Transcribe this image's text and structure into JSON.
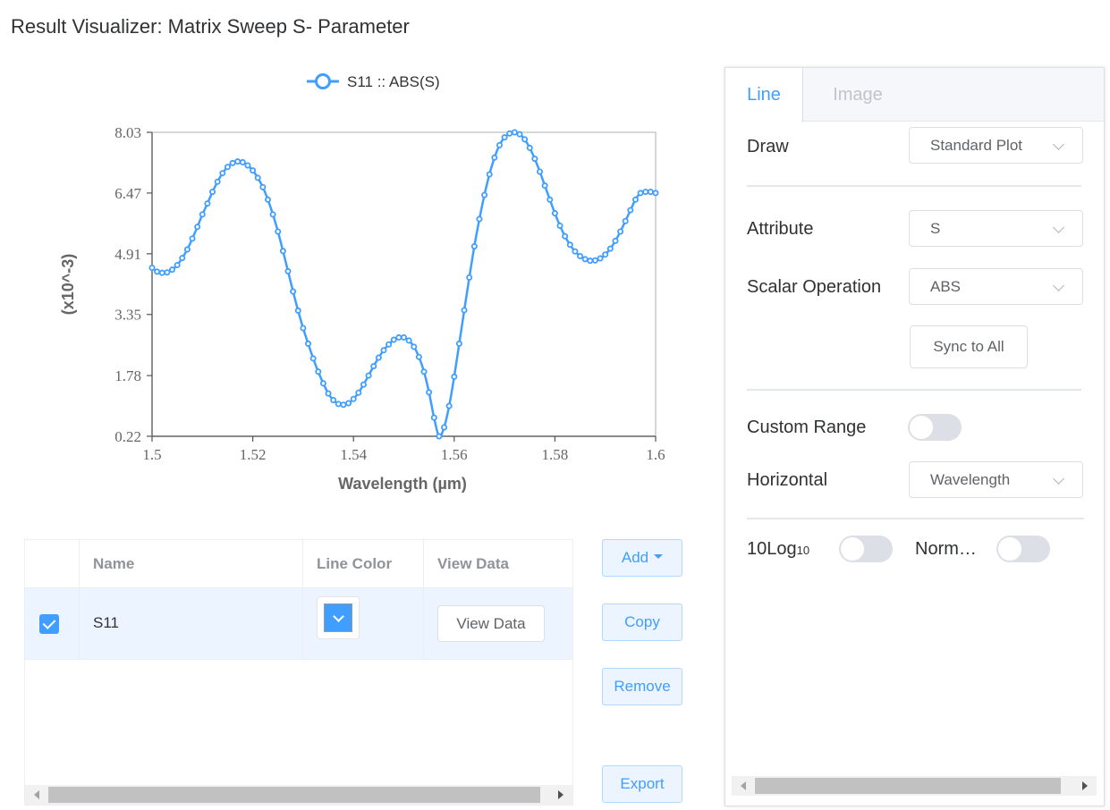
{
  "page": {
    "title": "Result Visualizer: Matrix Sweep S- Parameter"
  },
  "chart_data": {
    "type": "line",
    "title": "",
    "xlabel": "Wavelength (µm)",
    "ylabel": "(x10^-3)",
    "xlim": [
      1.5,
      1.6
    ],
    "ylim": [
      0.22,
      8.03
    ],
    "x_ticks": [
      "1.5",
      "1.52",
      "1.54",
      "1.56",
      "1.58",
      "1.6"
    ],
    "y_ticks": [
      "8.03",
      "6.47",
      "4.91",
      "3.35",
      "1.78",
      "0.22"
    ],
    "grid": false,
    "legend_position": "top-center",
    "series": [
      {
        "name": "S11 :: ABS(S)",
        "color": "#409eff",
        "x": [
          1.5,
          1.501,
          1.502,
          1.503,
          1.504,
          1.505,
          1.506,
          1.507,
          1.508,
          1.509,
          1.51,
          1.511,
          1.512,
          1.513,
          1.514,
          1.515,
          1.516,
          1.517,
          1.518,
          1.519,
          1.52,
          1.521,
          1.522,
          1.523,
          1.524,
          1.525,
          1.526,
          1.527,
          1.528,
          1.529,
          1.53,
          1.531,
          1.532,
          1.533,
          1.534,
          1.535,
          1.536,
          1.537,
          1.538,
          1.539,
          1.54,
          1.541,
          1.542,
          1.543,
          1.544,
          1.545,
          1.546,
          1.547,
          1.548,
          1.549,
          1.55,
          1.551,
          1.552,
          1.553,
          1.554,
          1.555,
          1.556,
          1.557,
          1.558,
          1.559,
          1.56,
          1.561,
          1.562,
          1.563,
          1.564,
          1.565,
          1.566,
          1.567,
          1.568,
          1.569,
          1.57,
          1.571,
          1.572,
          1.573,
          1.574,
          1.575,
          1.576,
          1.577,
          1.578,
          1.579,
          1.58,
          1.581,
          1.582,
          1.583,
          1.584,
          1.585,
          1.586,
          1.587,
          1.588,
          1.589,
          1.59,
          1.591,
          1.592,
          1.593,
          1.594,
          1.595,
          1.596,
          1.597,
          1.598,
          1.599,
          1.6
        ],
        "y": [
          4.55,
          4.45,
          4.42,
          4.43,
          4.5,
          4.62,
          4.8,
          5.02,
          5.3,
          5.6,
          5.92,
          6.2,
          6.5,
          6.76,
          6.98,
          7.14,
          7.24,
          7.28,
          7.26,
          7.18,
          7.05,
          6.86,
          6.62,
          6.3,
          5.92,
          5.48,
          4.98,
          4.46,
          3.94,
          3.45,
          3.0,
          2.6,
          2.22,
          1.88,
          1.58,
          1.32,
          1.15,
          1.05,
          1.03,
          1.07,
          1.18,
          1.34,
          1.55,
          1.78,
          2.02,
          2.24,
          2.43,
          2.58,
          2.7,
          2.76,
          2.76,
          2.68,
          2.52,
          2.26,
          1.88,
          1.35,
          0.7,
          0.22,
          0.45,
          1.0,
          1.75,
          2.6,
          3.46,
          4.3,
          5.1,
          5.8,
          6.42,
          6.95,
          7.38,
          7.7,
          7.9,
          8.0,
          8.03,
          7.98,
          7.85,
          7.63,
          7.35,
          7.02,
          6.66,
          6.3,
          5.95,
          5.63,
          5.36,
          5.14,
          4.97,
          4.85,
          4.77,
          4.73,
          4.74,
          4.79,
          4.89,
          5.04,
          5.24,
          5.48,
          5.75,
          6.03,
          6.3,
          6.47,
          6.5,
          6.5,
          6.47
        ]
      }
    ]
  },
  "table": {
    "headers": {
      "name": "Name",
      "line_color": "Line Color",
      "view_data": "View Data"
    },
    "rows": [
      {
        "checked": true,
        "name": "S11",
        "color": "#409eff",
        "view_label": "View Data"
      }
    ]
  },
  "actions": {
    "add": "Add",
    "copy": "Copy",
    "remove": "Remove",
    "export": "Export"
  },
  "panel": {
    "tabs": {
      "line": "Line",
      "image": "Image"
    },
    "draw": {
      "label": "Draw",
      "value": "Standard Plot"
    },
    "attribute": {
      "label": "Attribute",
      "value": "S"
    },
    "scalar": {
      "label": "Scalar Operation",
      "value": "ABS"
    },
    "sync_label": "Sync to All",
    "custom_range": {
      "label": "Custom Range",
      "on": false
    },
    "horizontal": {
      "label": "Horizontal",
      "value": "Wavelength"
    },
    "log": {
      "label": "10Log",
      "sub": "10",
      "on": false
    },
    "norm": {
      "label": "Norm…",
      "on": false
    }
  },
  "colors": {
    "accent": "#409eff",
    "accent_light": "#ecf5ff"
  }
}
